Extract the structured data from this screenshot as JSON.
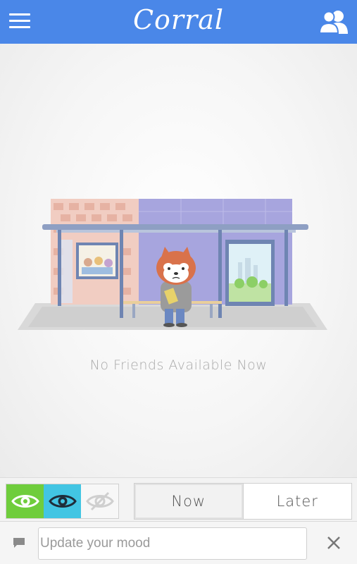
{
  "header": {
    "logo_text": "Corral",
    "menu_icon": "hamburger-menu-icon",
    "friends_icon": "friends-icon",
    "bar_color": "#4a87e8"
  },
  "main": {
    "illustration": "bus-stop-red-panda-illustration",
    "empty_message": "No Friends Available Now"
  },
  "filters": {
    "visibility": [
      {
        "icon": "eye-icon",
        "color": "#6fcd3c"
      },
      {
        "icon": "eye-icon",
        "color": "#42c5e3"
      },
      {
        "icon": "eye-off-icon",
        "color": "#f7f7f7"
      }
    ],
    "time_tabs": [
      {
        "label": "Now",
        "selected": true
      },
      {
        "label": "Later",
        "selected": false
      }
    ]
  },
  "mood": {
    "chat_icon": "chat-bubble-icon",
    "placeholder": "Update your mood",
    "value": "",
    "clear_icon": "close-icon"
  }
}
